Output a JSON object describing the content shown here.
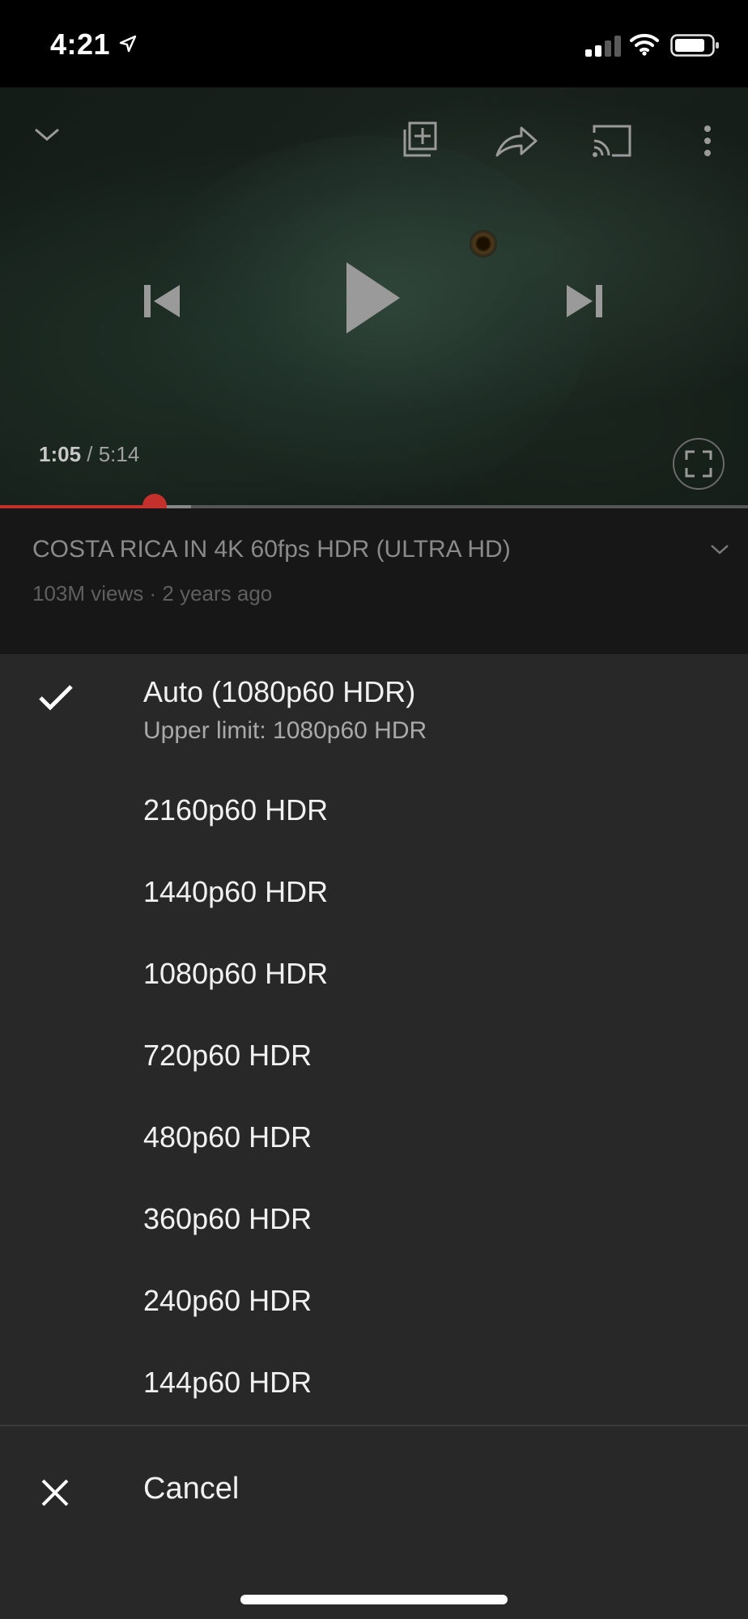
{
  "status_bar": {
    "time": "4:21",
    "icons": [
      "location-arrow-icon",
      "cellular-signal-icon",
      "wifi-icon",
      "battery-icon"
    ]
  },
  "player": {
    "current_time": "1:05",
    "separator": " / ",
    "duration": "5:14",
    "progress_fraction": 0.207,
    "buffer_fraction": 0.255,
    "accent_color": "#c4302b",
    "controls": [
      "chevron-down-icon",
      "add-to-playlist-icon",
      "share-icon",
      "cast-icon",
      "more-vert-icon",
      "previous-icon",
      "play-icon",
      "next-icon",
      "fullscreen-icon"
    ]
  },
  "video": {
    "title": "COSTA RICA IN 4K 60fps HDR (ULTRA HD)",
    "meta": "103M views · 2 years ago"
  },
  "quality_sheet": {
    "options": [
      {
        "label": "Auto (1080p60 HDR)",
        "sublabel": "Upper limit: 1080p60 HDR",
        "selected": true
      },
      {
        "label": "2160p60 HDR"
      },
      {
        "label": "1440p60 HDR"
      },
      {
        "label": "1080p60 HDR"
      },
      {
        "label": "720p60 HDR"
      },
      {
        "label": "480p60 HDR"
      },
      {
        "label": "360p60 HDR"
      },
      {
        "label": "240p60 HDR"
      },
      {
        "label": "144p60 HDR"
      }
    ],
    "cancel_label": "Cancel"
  }
}
